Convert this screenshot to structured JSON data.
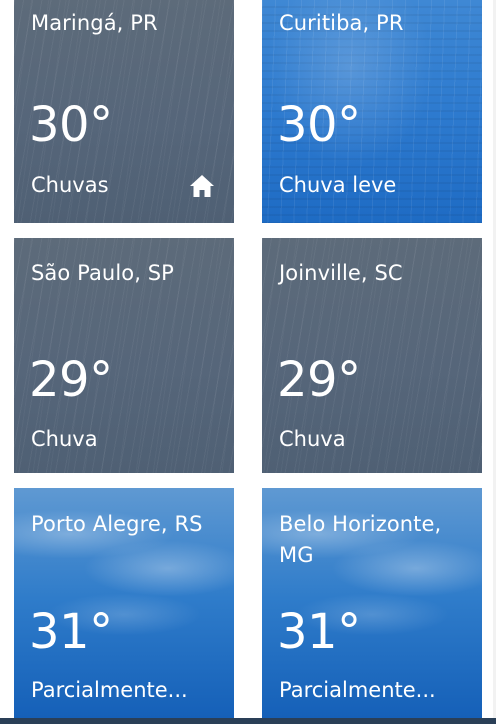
{
  "tiles": [
    {
      "city": "Maringá, PR",
      "temp": "30°",
      "condition": "Chuvas",
      "style": "gray",
      "home": true
    },
    {
      "city": "Curitiba, PR",
      "temp": "30°",
      "condition": "Chuva leve",
      "style": "lightrain",
      "home": false
    },
    {
      "city": "São Paulo, SP",
      "temp": "29°",
      "condition": "Chuva",
      "style": "gray",
      "home": false
    },
    {
      "city": "Joinville, SC",
      "temp": "29°",
      "condition": "Chuva",
      "style": "gray",
      "home": false
    },
    {
      "city": "Porto Alegre, RS",
      "temp": "31°",
      "condition": "Parcialmente...",
      "style": "partly",
      "home": false
    },
    {
      "city": "Belo Horizonte, MG",
      "temp": "31°",
      "condition": "Parcialmente...",
      "style": "partly",
      "home": false
    }
  ],
  "icons": {
    "home": "home-icon"
  },
  "colors": {
    "rain_gray": "#56667a",
    "light_rain_blue": "#2f7cd0",
    "partly_cloudy_blue": "#2f7cca",
    "text": "#ffffff"
  }
}
